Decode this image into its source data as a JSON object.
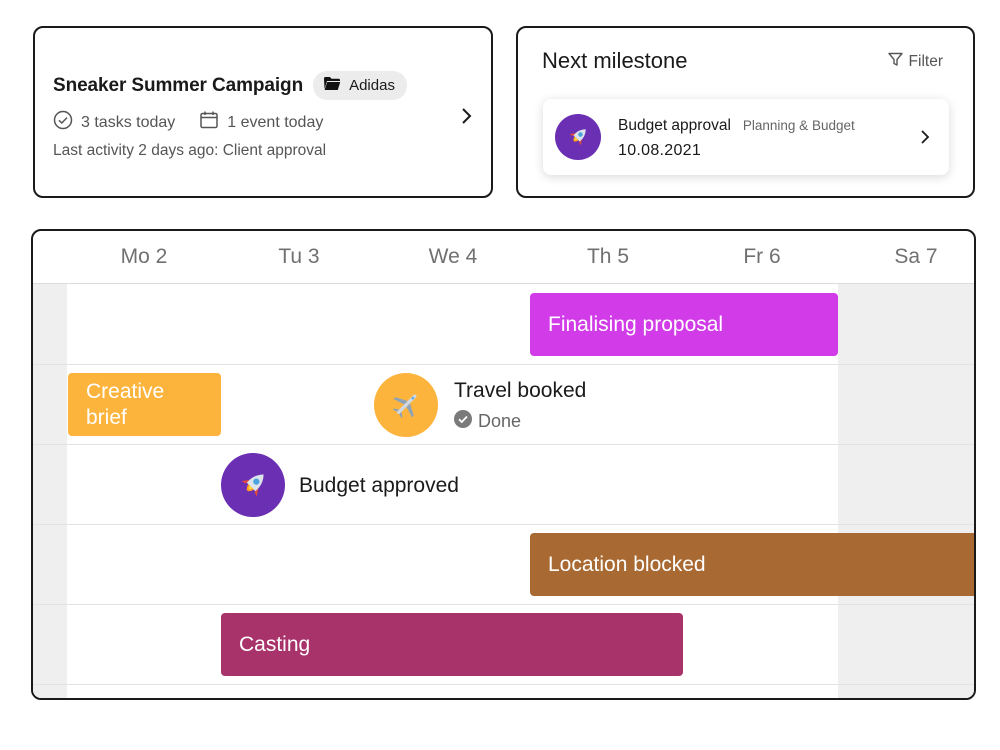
{
  "project": {
    "title": "Sneaker Summer Campaign",
    "client": "Adidas",
    "client_icon": "folder-icon",
    "tasks_text": "3 tasks today",
    "events_text": "1 event today",
    "last_activity": "Last activity 2 days ago: Client approval"
  },
  "milestone": {
    "heading": "Next milestone",
    "filter_label": "Filter",
    "item": {
      "name": "Budget approval",
      "category": "Planning & Budget",
      "date": "10.08.2021",
      "icon": "rocket-icon"
    }
  },
  "timeline": {
    "days": [
      "Mo 2",
      "Tu 3",
      "We 4",
      "Th 5",
      "Fr 6",
      "Sa 7"
    ],
    "bars": {
      "finalising": "Finalising proposal",
      "creative": "Creative brief",
      "location": "Location blocked",
      "casting": "Casting"
    },
    "events": {
      "travel": {
        "title": "Travel booked",
        "status": "Done",
        "icon": "airplane-icon"
      },
      "budget": {
        "title": "Budget approved",
        "icon": "rocket-icon"
      }
    }
  },
  "colors": {
    "purple_bar": "#d13be8",
    "orange": "#fdb43c",
    "brown": "#a86a32",
    "magenta": "#a8336b",
    "rocket_bg": "#6b2fb3"
  }
}
